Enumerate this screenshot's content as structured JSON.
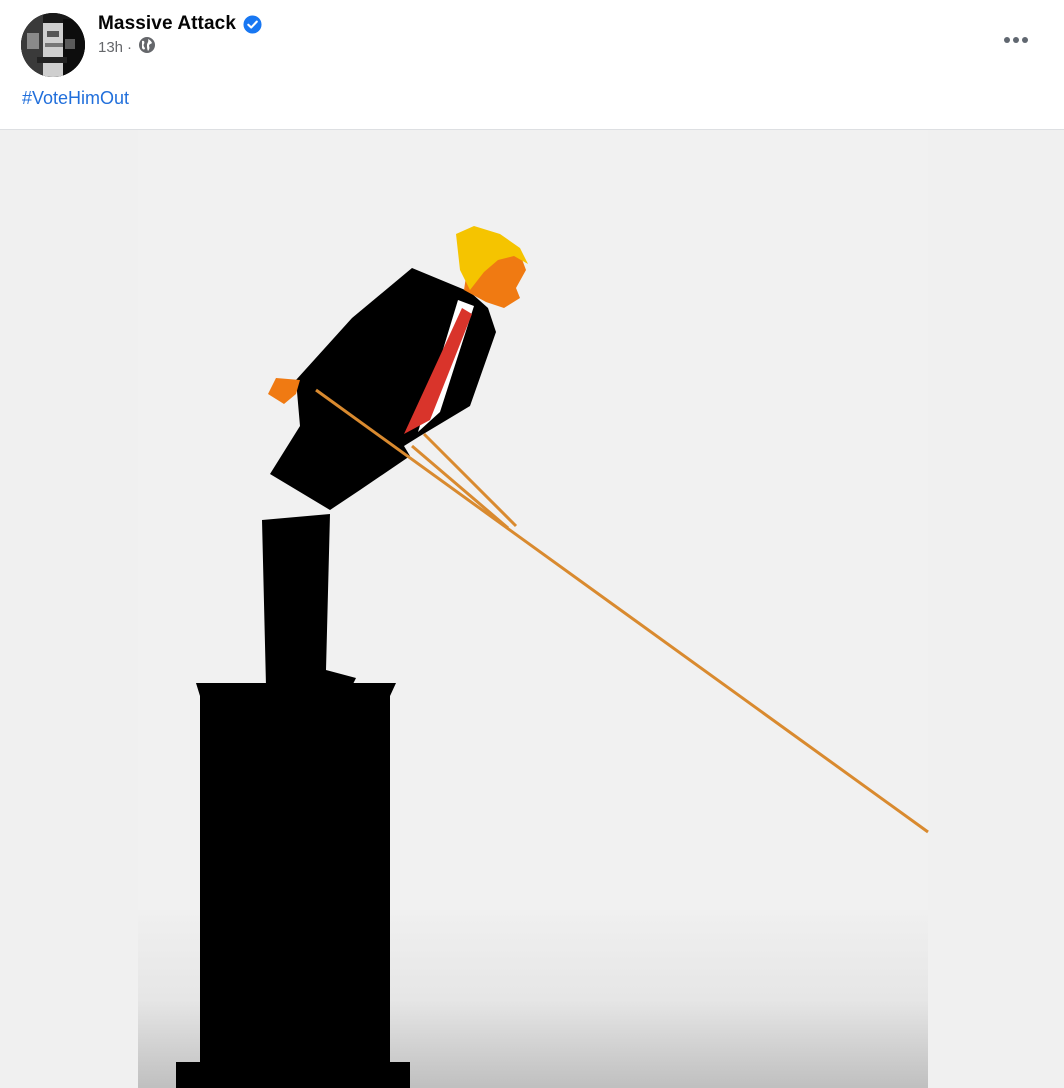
{
  "post": {
    "author": {
      "name": "Massive Attack",
      "verified": true,
      "avatar_icon": "profile-photo"
    },
    "timestamp": "13h",
    "separator": "·",
    "audience_icon": "globe-icon",
    "text": "#VoteHimOut",
    "more_icon": "more-options-icon",
    "image": {
      "description_icon": "statue-toppling-illustration"
    }
  },
  "colors": {
    "link": "#216fdb",
    "verified": "#1877f2",
    "meta": "#65676b",
    "hair": "#f5c400",
    "skin": "#f07a12",
    "tie": "#d9342b",
    "rope": "#d98a2f",
    "silhouette": "#000000",
    "media_bg": "#f0f0f0"
  }
}
